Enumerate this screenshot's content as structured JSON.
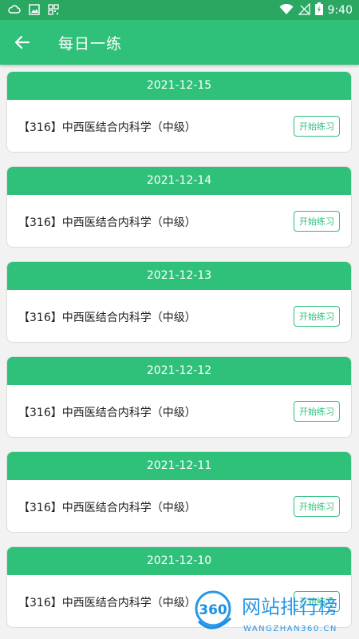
{
  "status_bar": {
    "time": "9:40",
    "icons": [
      "cloud-icon",
      "image-icon",
      "qr-icon",
      "wifi-icon",
      "no-signal-icon",
      "battery-charging-icon"
    ]
  },
  "header": {
    "title": "每日一练",
    "back_icon": "arrow-left-icon"
  },
  "practice_list": [
    {
      "date": "2021-12-15",
      "course": "【316】中西医结合内科学（中级）",
      "button": "开始练习"
    },
    {
      "date": "2021-12-14",
      "course": "【316】中西医结合内科学（中级）",
      "button": "开始练习"
    },
    {
      "date": "2021-12-13",
      "course": "【316】中西医结合内科学（中级）",
      "button": "开始练习"
    },
    {
      "date": "2021-12-12",
      "course": "【316】中西医结合内科学（中级）",
      "button": "开始练习"
    },
    {
      "date": "2021-12-11",
      "course": "【316】中西医结合内科学（中级）",
      "button": "开始练习"
    },
    {
      "date": "2021-12-10",
      "course": "【316】中西医结合内科学（中级）",
      "button": "开始练习"
    }
  ],
  "watermark": {
    "logo_text": "360",
    "title": "网站排行榜",
    "url": "WANGZHAN360.CN"
  },
  "colors": {
    "status_bar": "#2aa862",
    "primary": "#2fc07a",
    "background": "#f2f2f2",
    "card": "#ffffff",
    "text": "#222222"
  }
}
